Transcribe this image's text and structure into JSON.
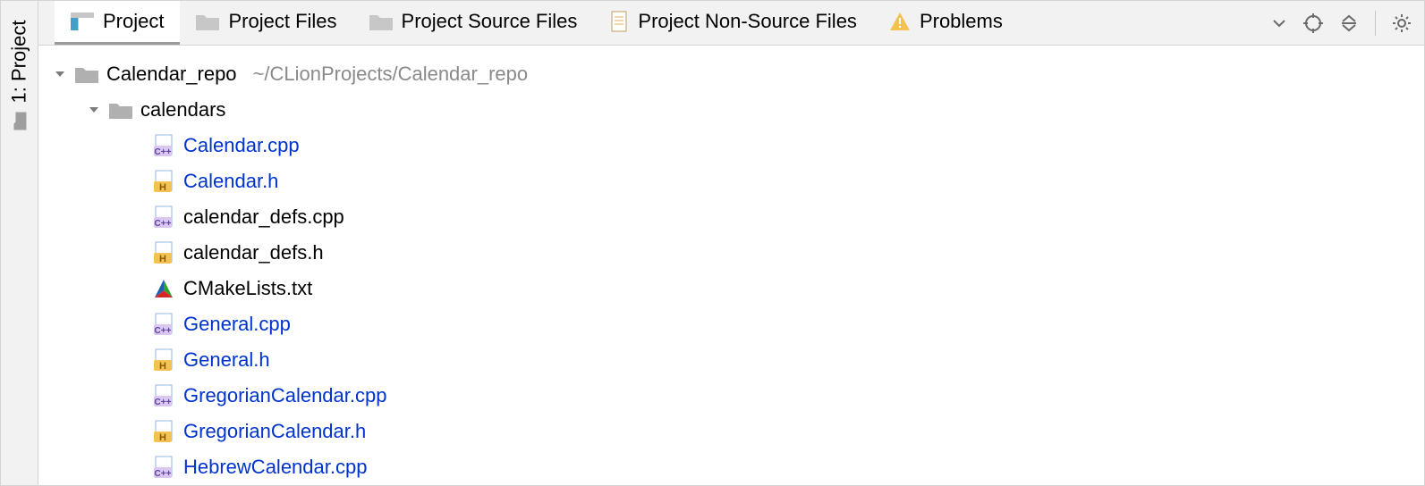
{
  "sidebar": {
    "label": "1: Project"
  },
  "tabs": [
    {
      "label": "Project",
      "icon": "window-icon",
      "active": true
    },
    {
      "label": "Project Files",
      "icon": "folder-icon",
      "active": false
    },
    {
      "label": "Project Source Files",
      "icon": "folder-icon",
      "active": false
    },
    {
      "label": "Project Non-Source Files",
      "icon": "file-icon",
      "active": false
    },
    {
      "label": "Problems",
      "icon": "warning-icon",
      "active": false
    }
  ],
  "toolbar": [
    {
      "name": "view-menu-button",
      "icon": "chevron-down-icon"
    },
    {
      "name": "target-button",
      "icon": "target-icon"
    },
    {
      "name": "collapse-all-button",
      "icon": "collapse-icon"
    },
    {
      "name": "separator",
      "icon": "separator"
    },
    {
      "name": "settings-button",
      "icon": "gear-icon"
    }
  ],
  "tree": [
    {
      "depth": 0,
      "kind": "folder",
      "expanded": true,
      "label": "Calendar_repo",
      "path": "~/CLionProjects/Calendar_repo",
      "link": false
    },
    {
      "depth": 1,
      "kind": "folder",
      "expanded": true,
      "label": "calendars",
      "link": false
    },
    {
      "depth": 2,
      "kind": "cpp",
      "label": "Calendar.cpp",
      "link": true
    },
    {
      "depth": 2,
      "kind": "h",
      "label": "Calendar.h",
      "link": true
    },
    {
      "depth": 2,
      "kind": "cpp",
      "label": "calendar_defs.cpp",
      "link": false
    },
    {
      "depth": 2,
      "kind": "h",
      "label": "calendar_defs.h",
      "link": false
    },
    {
      "depth": 2,
      "kind": "cmake",
      "label": "CMakeLists.txt",
      "link": false
    },
    {
      "depth": 2,
      "kind": "cpp",
      "label": "General.cpp",
      "link": true
    },
    {
      "depth": 2,
      "kind": "h",
      "label": "General.h",
      "link": true
    },
    {
      "depth": 2,
      "kind": "cpp",
      "label": "GregorianCalendar.cpp",
      "link": true
    },
    {
      "depth": 2,
      "kind": "h",
      "label": "GregorianCalendar.h",
      "link": true
    },
    {
      "depth": 2,
      "kind": "cpp",
      "label": "HebrewCalendar.cpp",
      "link": true
    }
  ],
  "colors": {
    "link": "#0033cc",
    "muted": "#8a8a8a"
  }
}
